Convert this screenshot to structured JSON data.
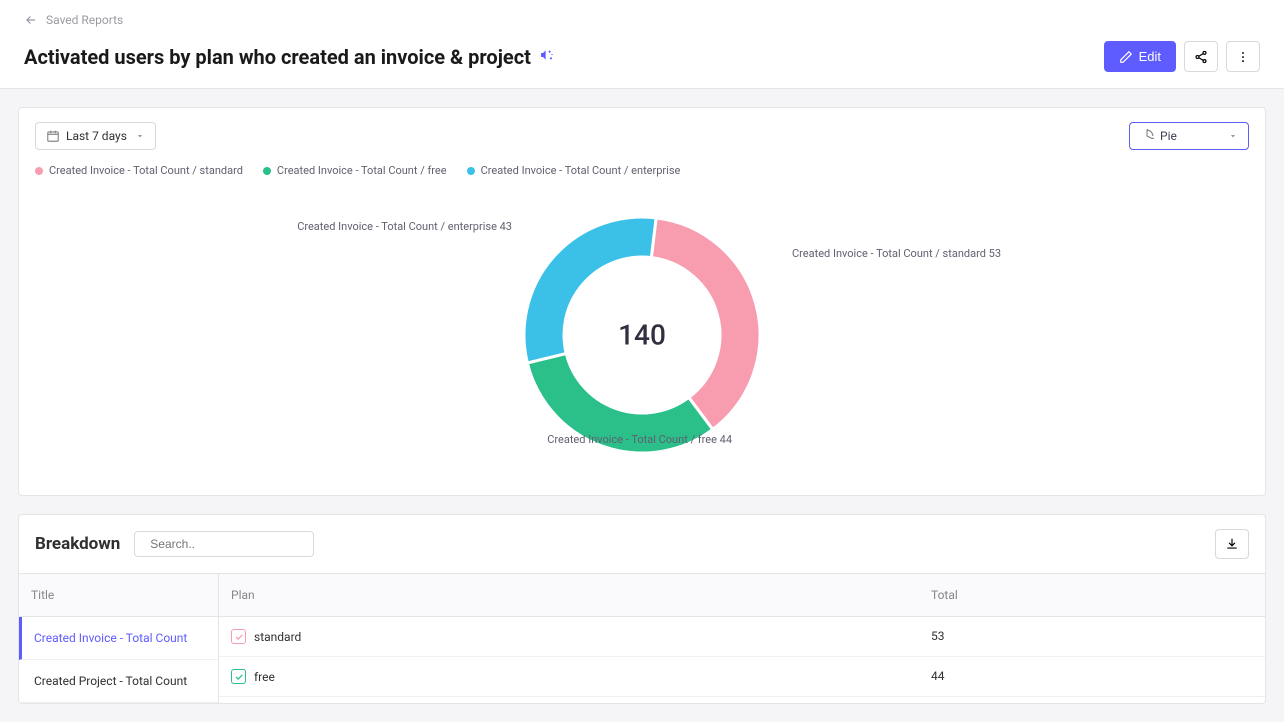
{
  "colors": {
    "standard": "#f89db0",
    "free": "#2bbf8a",
    "enterprise": "#3bc0e8",
    "primary": "#5f5cff"
  },
  "nav": {
    "back_label": "Saved Reports"
  },
  "header": {
    "title": "Activated users by plan who created an invoice & project",
    "edit_label": "Edit"
  },
  "controls": {
    "date_range": "Last 7 days",
    "viz_type": "Pie"
  },
  "legend": [
    {
      "label": "Created Invoice - Total Count / standard",
      "color": "#f89db0"
    },
    {
      "label": "Created Invoice - Total Count / free",
      "color": "#2bbf8a"
    },
    {
      "label": "Created Invoice - Total Count / enterprise",
      "color": "#3bc0e8"
    }
  ],
  "chart_data": {
    "type": "pie",
    "total_label": "140",
    "series": [
      {
        "name": "Created Invoice - Total Count / standard",
        "value": 53,
        "color": "#f89db0"
      },
      {
        "name": "Created Invoice - Total Count / free",
        "value": 44,
        "color": "#2bbf8a"
      },
      {
        "name": "Created Invoice - Total Count / enterprise",
        "value": 43,
        "color": "#3bc0e8"
      }
    ],
    "slice_labels": {
      "standard": "Created Invoice - Total Count / standard 53",
      "free": "Created Invoice - Total Count / free 44",
      "enterprise": "Created Invoice - Total Count / enterprise 43"
    }
  },
  "breakdown": {
    "title": "Breakdown",
    "search_placeholder": "Search..",
    "side_header": "Title",
    "side_items": [
      {
        "label": "Created Invoice - Total Count",
        "active": true
      },
      {
        "label": "Created Project - Total Count",
        "active": false
      }
    ],
    "columns": {
      "plan": "Plan",
      "total": "Total"
    },
    "rows": [
      {
        "plan": "standard",
        "total": "53",
        "color": "#f89db0"
      },
      {
        "plan": "free",
        "total": "44",
        "color": "#2bbf8a"
      }
    ]
  }
}
